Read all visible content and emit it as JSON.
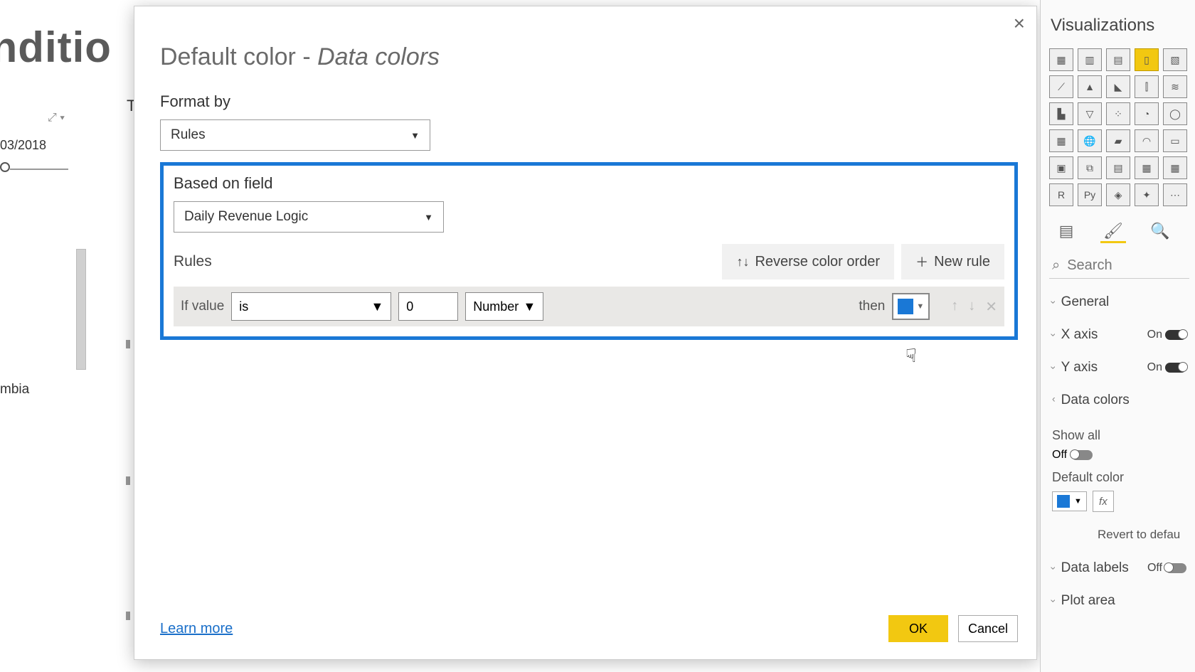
{
  "background": {
    "heading_fragment": "onditio",
    "date": "03/2018",
    "label_fragment": "mbia",
    "letter": "T"
  },
  "dialog": {
    "title_prefix": "Default color - ",
    "title_italic": "Data colors",
    "format_by_label": "Format by",
    "format_by_value": "Rules",
    "based_on_label": "Based on field",
    "based_on_value": "Daily Revenue Logic",
    "rules_label": "Rules",
    "reverse_btn": "Reverse color order",
    "new_rule_btn": "New rule",
    "rule": {
      "if_label": "If value",
      "operator": "is",
      "value": "0",
      "type": "Number",
      "then_label": "then",
      "color": "#1a78d6"
    },
    "learn_more": "Learn more",
    "ok": "OK",
    "cancel": "Cancel"
  },
  "viz": {
    "title": "Visualizations",
    "search": "Search",
    "items": {
      "general": "General",
      "xaxis": "X axis",
      "yaxis": "Y axis",
      "datacolors": "Data colors",
      "showall": "Show all",
      "off": "Off",
      "on": "On",
      "defcolor": "Default color",
      "revert": "Revert to defau",
      "datalabels": "Data labels",
      "plotarea": "Plot area"
    },
    "fx": "fx"
  }
}
